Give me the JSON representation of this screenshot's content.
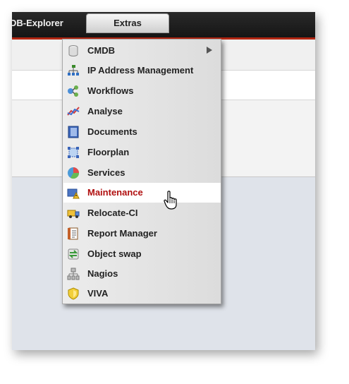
{
  "topbar": {
    "app_title": "DB-Explorer",
    "extras_label": "Extras"
  },
  "menu": {
    "items": [
      {
        "label": "CMDB",
        "icon": "database-icon",
        "submenu": true
      },
      {
        "label": "IP Address Management",
        "icon": "network-icon"
      },
      {
        "label": "Workflows",
        "icon": "workflow-icon"
      },
      {
        "label": "Analyse",
        "icon": "chart-line-icon"
      },
      {
        "label": "Documents",
        "icon": "document-icon"
      },
      {
        "label": "Floorplan",
        "icon": "floorplan-icon"
      },
      {
        "label": "Services",
        "icon": "pie-chart-icon"
      },
      {
        "label": "Maintenance",
        "icon": "maintenance-icon",
        "active": true
      },
      {
        "label": "Relocate-CI",
        "icon": "truck-icon"
      },
      {
        "label": "Report Manager",
        "icon": "report-icon"
      },
      {
        "label": "Object swap",
        "icon": "swap-icon"
      },
      {
        "label": "Nagios",
        "icon": "server-tree-icon"
      },
      {
        "label": "VIVA",
        "icon": "shield-icon"
      }
    ]
  },
  "colors": {
    "accent_red": "#b22612",
    "active_label": "#b00f0f"
  },
  "cursor": "hand-pointer-icon"
}
